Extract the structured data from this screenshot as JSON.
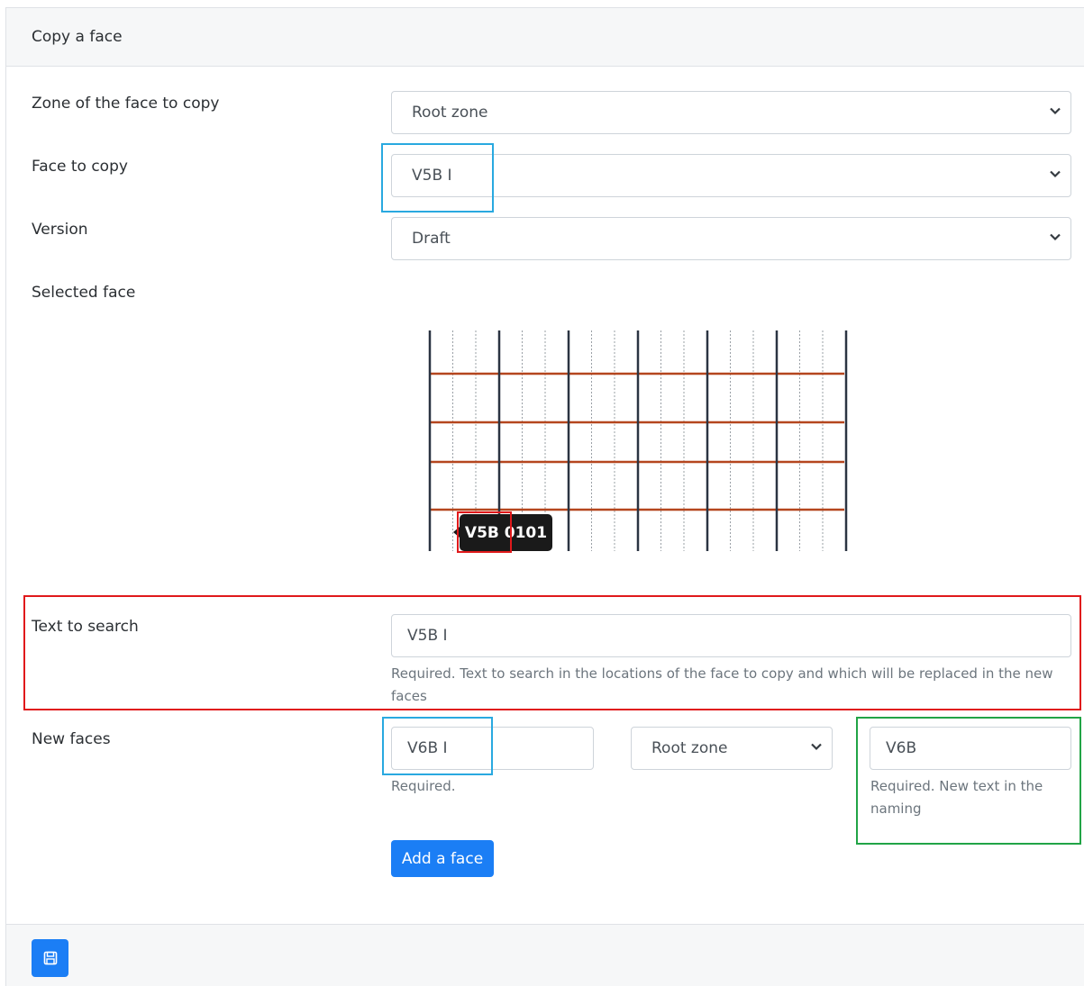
{
  "card": {
    "title": "Copy a face"
  },
  "zone_field": {
    "label": "Zone of the face to copy",
    "value": "Root zone"
  },
  "face_field": {
    "label": "Face to copy",
    "value": "V5B I"
  },
  "version_field": {
    "label": "Version",
    "value": "Draft"
  },
  "selected_face": {
    "label": "Selected face",
    "tooltip": "V5B 0101",
    "colors": {
      "upright": "#2b3442",
      "beam": "#b5461e",
      "grid_dotted": "#9aa0a6"
    }
  },
  "text_to_search": {
    "label": "Text to search",
    "value": "V5B I",
    "help": "Required. Text to search in the locations of the face to copy and which will be replaced in the new faces"
  },
  "new_faces": {
    "label": "New faces",
    "name_value": "V6B I",
    "name_help": "Required.",
    "zone_value": "Root zone",
    "replacement_value": "V6B",
    "replacement_help": "Required. New text in the naming"
  },
  "actions": {
    "add_face_label": "Add a face"
  },
  "colors": {
    "primary": "#1b7ef5",
    "highlight_blue": "#29a9e0",
    "highlight_red": "#e0191b",
    "highlight_green": "#21a446"
  }
}
